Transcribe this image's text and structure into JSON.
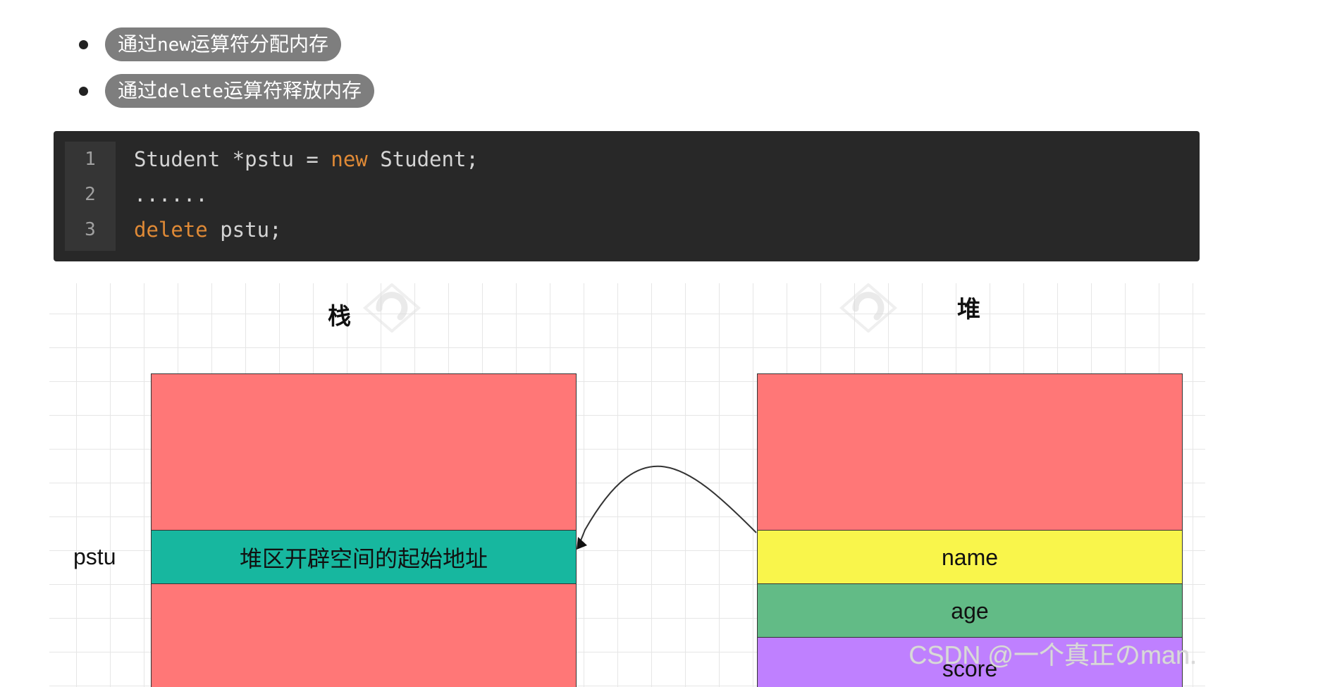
{
  "bullets": [
    {
      "prefix": "通过",
      "code": "new",
      "suffix": "运算符分配内存"
    },
    {
      "prefix": "通过",
      "code": "delete",
      "suffix": "运算符释放内存"
    }
  ],
  "code": {
    "lines": [
      {
        "number": "1",
        "parts": [
          {
            "text": "Student *pstu = ",
            "kind": "plain"
          },
          {
            "text": "new",
            "kind": "keyword"
          },
          {
            "text": " Student;",
            "kind": "plain"
          }
        ]
      },
      {
        "number": "2",
        "parts": [
          {
            "text": "......",
            "kind": "plain"
          }
        ]
      },
      {
        "number": "3",
        "parts": [
          {
            "text": "delete",
            "kind": "keyword"
          },
          {
            "text": " pstu;",
            "kind": "plain"
          }
        ]
      }
    ]
  },
  "diagram": {
    "stack_title": "栈",
    "heap_title": "堆",
    "pointer_label": "pstu",
    "stack_cell_text": "堆区开辟空间的起始地址",
    "heap_fields": [
      "name",
      "age",
      "score"
    ],
    "colors": {
      "memory": "#ff7777",
      "pointer_cell": "#17b79f",
      "name": "#f9f54b",
      "age": "#62bb86",
      "score": "#bf80ff"
    }
  },
  "watermark": "CSDN @一个真正のman."
}
